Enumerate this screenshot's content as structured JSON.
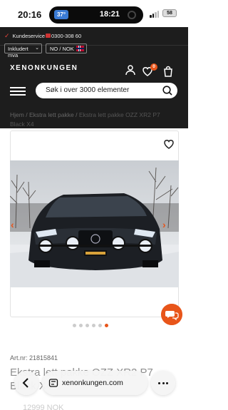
{
  "status": {
    "time": "20:16",
    "island_badge": "37°",
    "island_time": "18:21",
    "battery": "58"
  },
  "topbar": {
    "customer_service_label": "Kundeservice",
    "customer_service_phone": "0300-308 60",
    "vat_option": "Inkludert mva",
    "country_option": "NO / NOK",
    "logo_text": "XENONKUNGEN",
    "wishlist_count": "0",
    "accent_color": "#e8551a"
  },
  "search": {
    "placeholder": "Søk i over 3000 elementer"
  },
  "breadcrumb": {
    "items": [
      "Hjem",
      "Ekstra lett pakke",
      "Ekstra lett pakke OZZ XR2 P7 Black X4"
    ],
    "separator": " / "
  },
  "gallery": {
    "image_count": 6,
    "active_index": 6
  },
  "product": {
    "art_nr": "Art.nr: 21815841",
    "title": "Ekstra lett pakke OZZ XR2 P7 Black X4",
    "price": "12999 NOK"
  },
  "browser": {
    "url": "xenonkungen.com"
  }
}
